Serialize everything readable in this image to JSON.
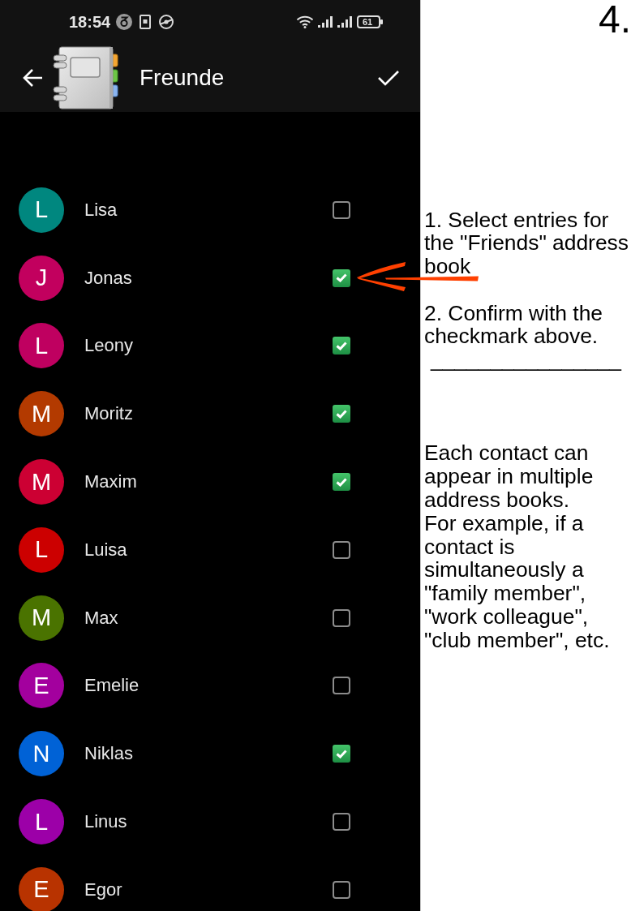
{
  "status_bar": {
    "time": "18:54",
    "battery": "61"
  },
  "app_bar": {
    "title": "Freunde"
  },
  "contacts": [
    {
      "initial": "L",
      "name": "Lisa",
      "color": "#00877f",
      "checked": false
    },
    {
      "initial": "J",
      "name": "Jonas",
      "color": "#c2005e",
      "checked": true
    },
    {
      "initial": "L",
      "name": "Leony",
      "color": "#bf0060",
      "checked": true
    },
    {
      "initial": "M",
      "name": "Moritz",
      "color": "#b33a00",
      "checked": true
    },
    {
      "initial": "M",
      "name": "Maxim",
      "color": "#cc0033",
      "checked": true
    },
    {
      "initial": "L",
      "name": "Luisa",
      "color": "#cc0000",
      "checked": false
    },
    {
      "initial": "M",
      "name": "Max",
      "color": "#4a7300",
      "checked": false
    },
    {
      "initial": "E",
      "name": "Emelie",
      "color": "#a3009e",
      "checked": false
    },
    {
      "initial": "N",
      "name": "Niklas",
      "color": "#0062d6",
      "checked": true
    },
    {
      "initial": "L",
      "name": "Linus",
      "color": "#9c00a8",
      "checked": false
    },
    {
      "initial": "E",
      "name": "Egor",
      "color": "#b83300",
      "checked": false
    }
  ],
  "instructions": {
    "step_number": "4.",
    "steps": [
      "1. Select entries for the \"Friends\" address book",
      "2. Confirm with the checkmark above."
    ],
    "separator": "________________",
    "notes": [
      "Each contact can appear in multiple address books.",
      "For example, if a contact is simultaneously a \"family member\", \"work colleague\", \"club member\", etc."
    ]
  }
}
